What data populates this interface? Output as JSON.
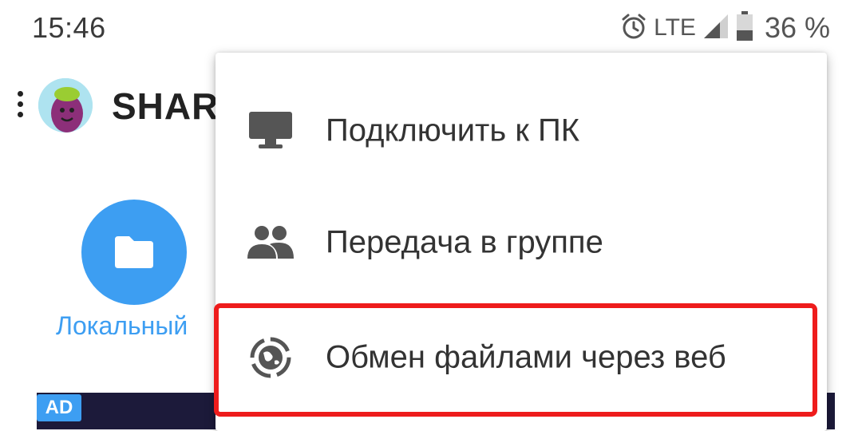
{
  "status_bar": {
    "time": "15:46",
    "network": "LTE",
    "battery": "36 %",
    "icons": [
      "alarm-icon",
      "signal-icon",
      "battery-icon"
    ]
  },
  "header": {
    "title": "SHAR",
    "avatar_icon": "eggplant-avatar"
  },
  "main": {
    "local_label": "Локальный",
    "local_icon": "folder-icon",
    "ad_badge": "AD"
  },
  "menu": {
    "items": [
      {
        "label": "Подключить к ПК",
        "icon": "monitor-icon"
      },
      {
        "label": "Передача в группе",
        "icon": "group-icon"
      },
      {
        "label": "Обмен файлами через веб",
        "icon": "web-share-icon"
      }
    ],
    "highlighted_index": 2
  },
  "colors": {
    "accent": "#3d9ef2",
    "highlight": "#ee1c1c",
    "icon": "#555555",
    "text": "#333333"
  }
}
